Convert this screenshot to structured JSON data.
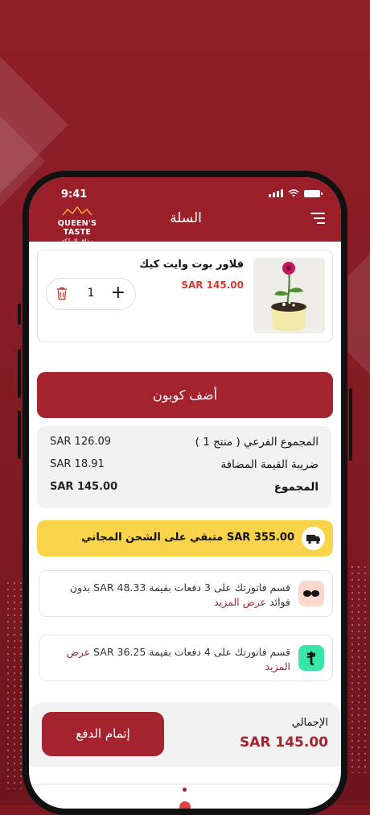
{
  "status_bar": {
    "time": "9:41"
  },
  "header": {
    "brand_en": "QUEEN'S TASTE",
    "brand_ar": "مذاق الملكة",
    "title": "السلة"
  },
  "cart_item": {
    "name": "فلاور بوت وايت كيك",
    "price": "SAR 145.00",
    "quantity": "1"
  },
  "coupon": {
    "label": "أضف كوبون"
  },
  "summary": {
    "subtotal_label": "المجموع الفرعي ( منتج 1 )",
    "subtotal_value": "SAR 126.09",
    "vat_label": "ضريبة القيمة المضافة",
    "vat_value": "SAR 18.91",
    "total_label": "المجموع",
    "total_value": "SAR 145.00"
  },
  "shipping_banner": {
    "text": "متبقي على الشحن المجاني SAR 355.00"
  },
  "installments": [
    {
      "provider_icon": "tabby-icon",
      "text": "قسم فاتورتك على 3 دفعات بقيمة SAR 48.33 بدون فوائد",
      "more": "عرض المزيد",
      "brand_color": "#ffd6cc"
    },
    {
      "provider_icon": "tamara-icon",
      "text": "قسم فاتورتك على 4 دفعات بقيمة SAR 36.25",
      "more": "عرض المزيد",
      "brand_color": "#3ae5a8"
    }
  ],
  "checkout": {
    "total_label": "الإجمالي",
    "total_value": "SAR 145.00",
    "button_label": "إتمام الدفع"
  },
  "colors": {
    "brand": "#a3232f",
    "price": "#d23b2f",
    "banner": "#f9d349"
  }
}
